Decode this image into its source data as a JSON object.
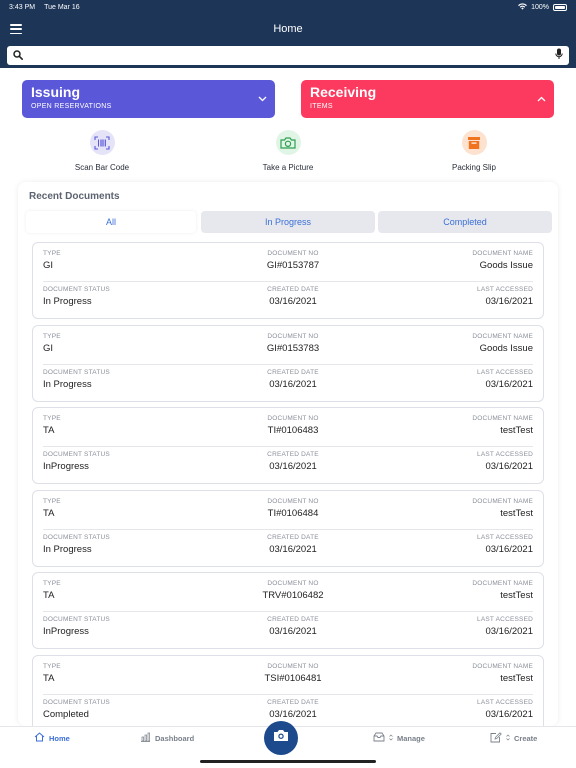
{
  "status": {
    "time": "3:43 PM",
    "date": "Tue Mar 16",
    "battery": "100%"
  },
  "header": {
    "title": "Home"
  },
  "search": {
    "placeholder": ""
  },
  "actions": {
    "issuing": {
      "title": "Issuing",
      "subtitle": "OPEN RESERVATIONS",
      "color": "#5a57d9"
    },
    "receiving": {
      "title": "Receiving",
      "subtitle": "ITEMS",
      "color": "#fc3a5f"
    }
  },
  "quick": {
    "scan": "Scan Bar Code",
    "picture": "Take a Picture",
    "packing": "Packing Slip"
  },
  "recent": {
    "title": "Recent Documents",
    "tabs": {
      "all": "All",
      "in_progress": "In Progress",
      "completed": "Completed"
    },
    "labels": {
      "type": "TYPE",
      "doc_no": "DOCUMENT NO",
      "doc_name": "DOCUMENT NAME",
      "status": "DOCUMENT STATUS",
      "created": "CREATED DATE",
      "accessed": "LAST ACCESSED"
    },
    "docs": [
      {
        "type": "GI",
        "no": "GI#0153787",
        "name": "Goods Issue",
        "status": "In Progress",
        "created": "03/16/2021",
        "accessed": "03/16/2021"
      },
      {
        "type": "GI",
        "no": "GI#0153783",
        "name": "Goods Issue",
        "status": "In Progress",
        "created": "03/16/2021",
        "accessed": "03/16/2021"
      },
      {
        "type": "TA",
        "no": "TI#0106483",
        "name": "testTest",
        "status": "InProgress",
        "created": "03/16/2021",
        "accessed": "03/16/2021"
      },
      {
        "type": "TA",
        "no": "TI#0106484",
        "name": "testTest",
        "status": "In Progress",
        "created": "03/16/2021",
        "accessed": "03/16/2021"
      },
      {
        "type": "TA",
        "no": "TRV#0106482",
        "name": "testTest",
        "status": "InProgress",
        "created": "03/16/2021",
        "accessed": "03/16/2021"
      },
      {
        "type": "TA",
        "no": "TSI#0106481",
        "name": "testTest",
        "status": "Completed",
        "created": "03/16/2021",
        "accessed": "03/16/2021"
      }
    ]
  },
  "tabbar": {
    "home": "Home",
    "dashboard": "Dashboard",
    "manage": "Manage",
    "create": "Create"
  }
}
